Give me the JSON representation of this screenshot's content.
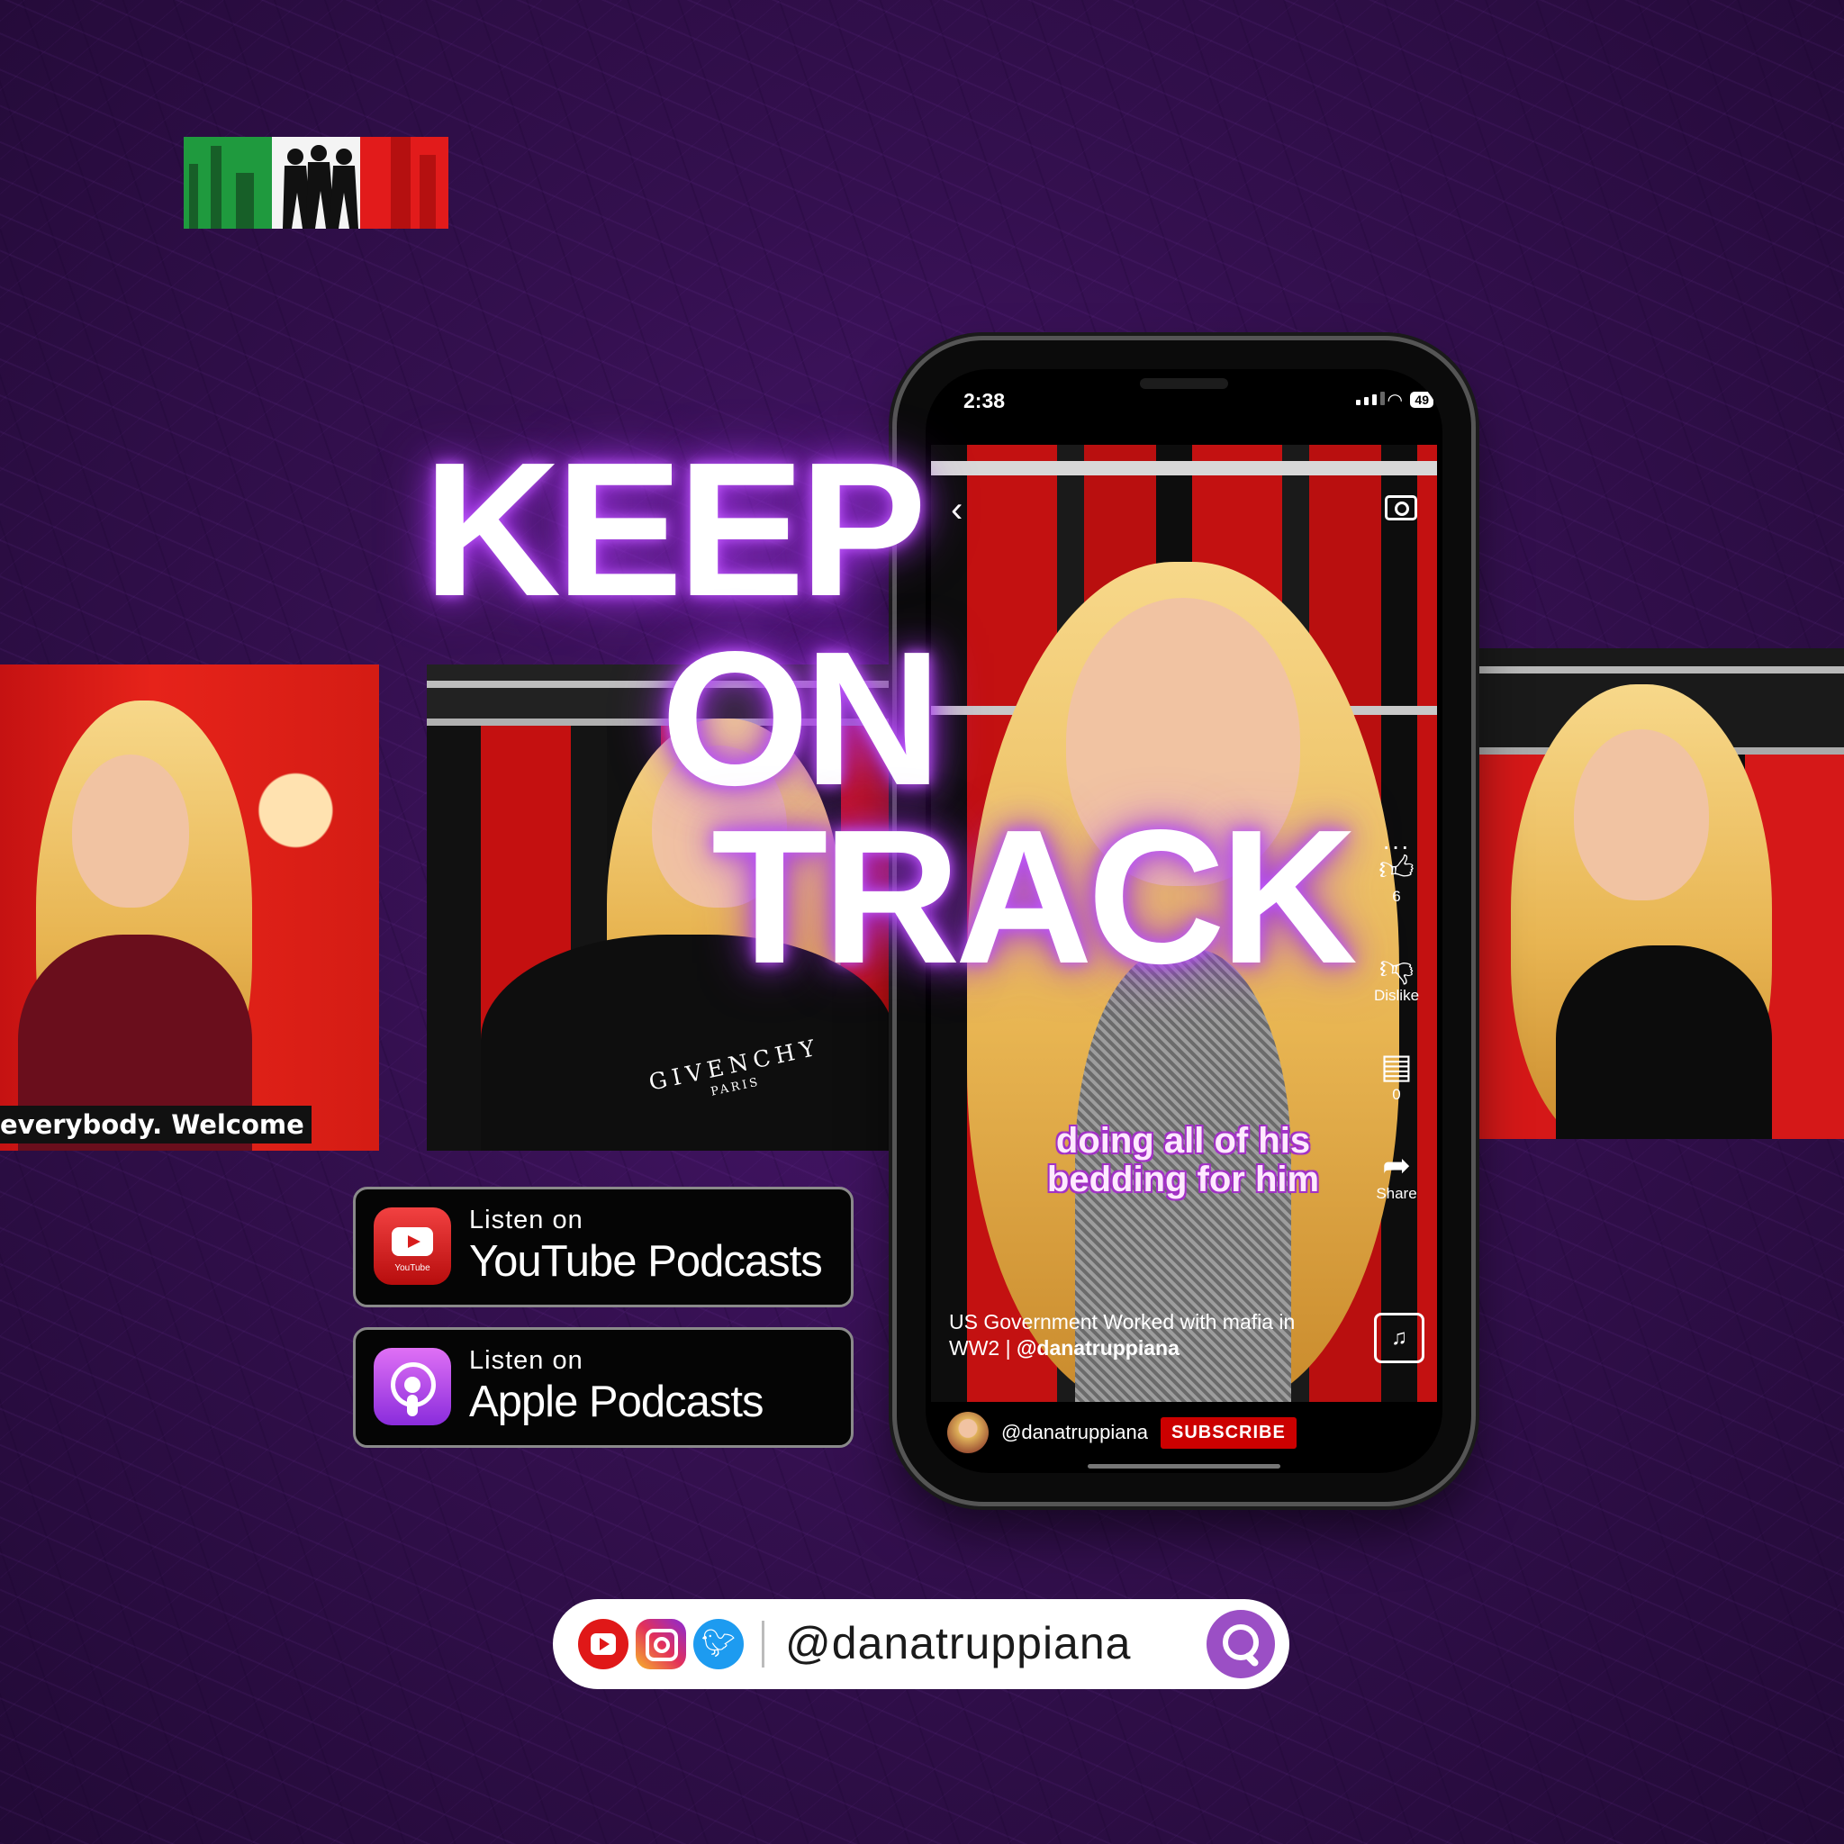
{
  "headline": {
    "line1": "KEEP",
    "line2": "ON",
    "line3": "TRACK"
  },
  "left_clip": {
    "caption": "everybody. Welcome"
  },
  "center_clip": {
    "shirt_text": "GIVENCHY",
    "shirt_subtext": "PARIS"
  },
  "phone": {
    "status": {
      "time": "2:38",
      "battery": "49"
    },
    "rail": {
      "likes": "6",
      "dislike_label": "Dislike",
      "comments": "0",
      "share_label": "Share"
    },
    "subtitle": "doing all of his bedding for him",
    "video_title": "US Government Worked with mafia in WW2 |",
    "video_title_handle": "@danatruppiana",
    "channel": "@danatruppiana",
    "subscribe_label": "SUBSCRIBE",
    "icons": {
      "back": "chevron-left-icon",
      "camera": "camera-icon",
      "like": "thumbs-up-icon",
      "dislike": "thumbs-down-icon",
      "comment": "comment-icon",
      "share": "share-icon",
      "sound": "sound-icon",
      "more": "more-icon"
    }
  },
  "podcasts": {
    "youtube": {
      "listen": "Listen on",
      "name": "YouTube Podcasts",
      "icon_label": "YouTube"
    },
    "apple": {
      "listen": "Listen on",
      "name": "Apple Podcasts"
    }
  },
  "social": {
    "handle": "@danatruppiana",
    "icons": [
      "youtube-icon",
      "instagram-icon",
      "twitter-icon",
      "search-icon"
    ]
  },
  "colors": {
    "background": "#34104f",
    "glow": "#c25cff",
    "subscribe": "#cc0000",
    "flag_green": "#1f9a3e",
    "flag_red": "#e21b1b"
  }
}
